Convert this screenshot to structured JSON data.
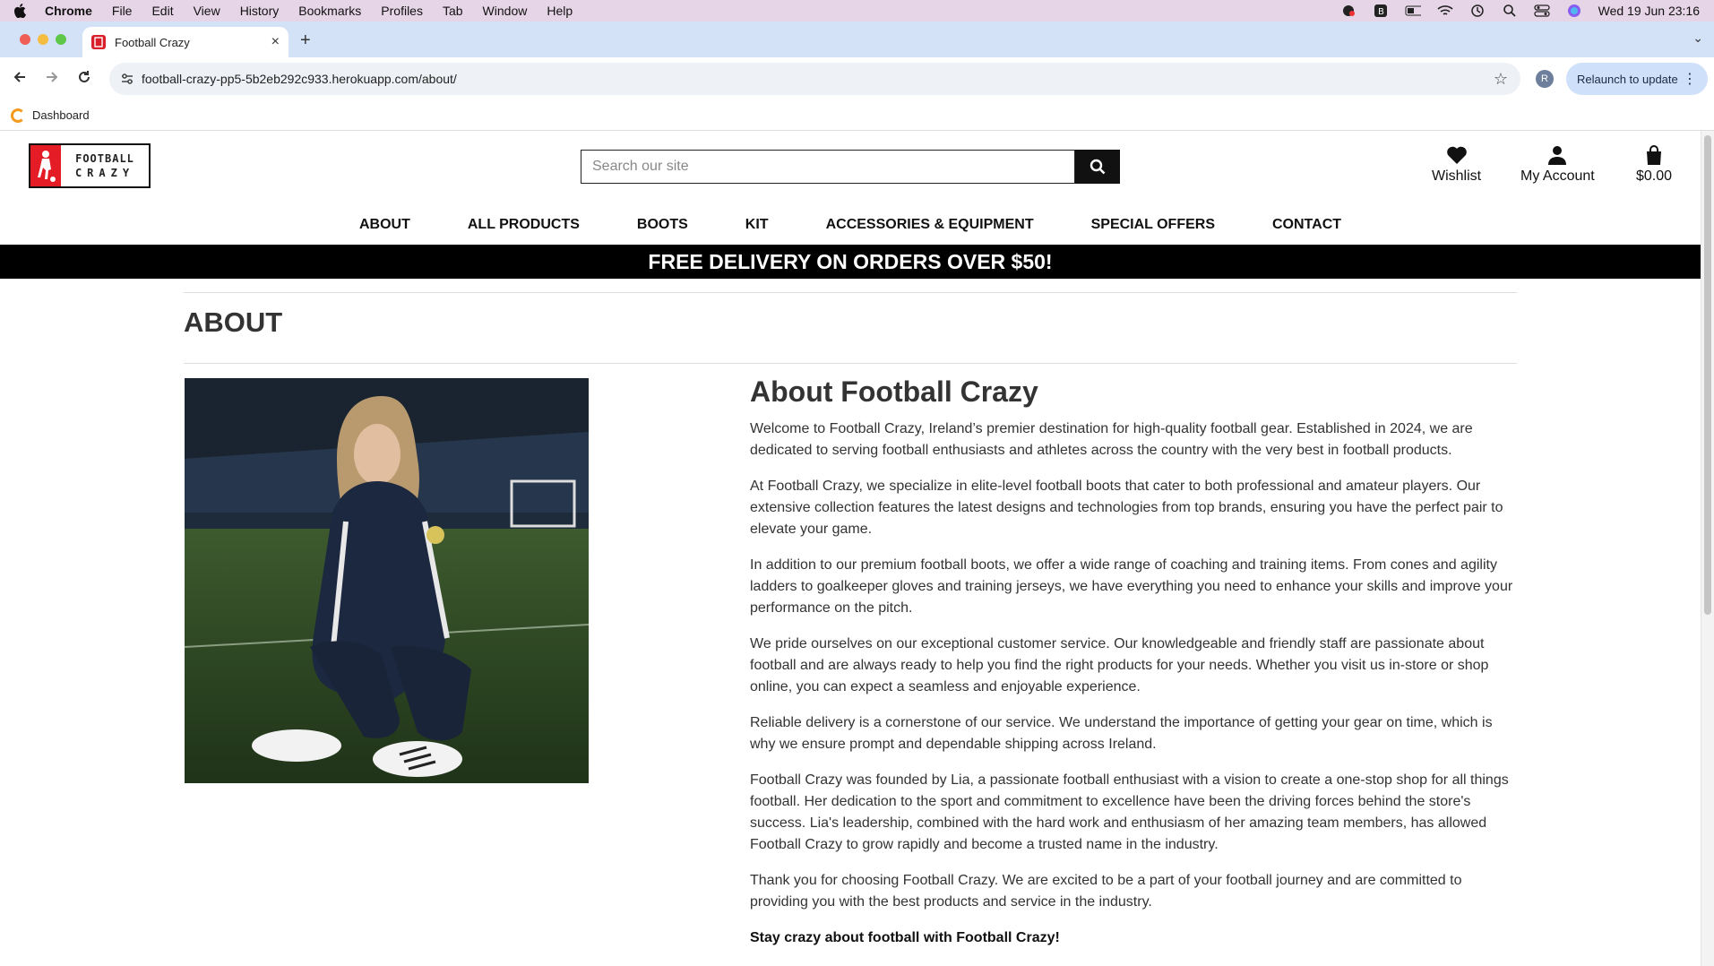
{
  "os_menubar": {
    "app_name": "Chrome",
    "menus": [
      "File",
      "Edit",
      "View",
      "History",
      "Bookmarks",
      "Profiles",
      "Tab",
      "Window",
      "Help"
    ],
    "datetime": "Wed 19 Jun  23:16"
  },
  "browser": {
    "tab_title": "Football Crazy",
    "url": "football-crazy-pp5-5b2eb292c933.herokuapp.com/about/",
    "profile_initial": "R",
    "relaunch_label": "Relaunch to update",
    "bookmarks": [
      {
        "label": "Dashboard"
      }
    ]
  },
  "header": {
    "logo_line1": "FOOTBALL",
    "logo_line2": "CRAZY",
    "search_placeholder": "Search our site",
    "wishlist_label": "Wishlist",
    "account_label": "My Account",
    "cart_total": "$0.00"
  },
  "nav": [
    "ABOUT",
    "ALL PRODUCTS",
    "BOOTS",
    "KIT",
    "ACCESSORIES & EQUIPMENT",
    "SPECIAL OFFERS",
    "CONTACT"
  ],
  "banner": "FREE DELIVERY ON ORDERS OVER $50!",
  "page": {
    "title": "ABOUT",
    "heading": "About Football Crazy",
    "paragraphs": [
      "Welcome to Football Crazy, Ireland’s premier destination for high-quality football gear. Established in 2024, we are dedicated to serving football enthusiasts and athletes across the country with the very best in football products.",
      "At Football Crazy, we specialize in elite-level football boots that cater to both professional and amateur players. Our extensive collection features the latest designs and technologies from top brands, ensuring you have the perfect pair to elevate your game.",
      "In addition to our premium football boots, we offer a wide range of coaching and training items. From cones and agility ladders to goalkeeper gloves and training jerseys, we have everything you need to enhance your skills and improve your performance on the pitch.",
      "We pride ourselves on our exceptional customer service. Our knowledgeable and friendly staff are passionate about football and are always ready to help you find the right products for your needs. Whether you visit us in-store or shop online, you can expect a seamless and enjoyable experience.",
      "Reliable delivery is a cornerstone of our service. We understand the importance of getting your gear on time, which is why we ensure prompt and dependable shipping across Ireland.",
      "Football Crazy was founded by Lia, a passionate football enthusiast with a vision to create a one-stop shop for all things football. Her dedication to the sport and commitment to excellence have been the driving forces behind the store's success. Lia's leadership, combined with the hard work and enthusiasm of her amazing team members, has allowed Football Crazy to grow rapidly and become a trusted name in the industry.",
      "Thank you for choosing Football Crazy. We are excited to be a part of your football journey and are committed to providing you with the best products and service in the industry."
    ],
    "closing": "Stay crazy about football with Football Crazy!"
  }
}
